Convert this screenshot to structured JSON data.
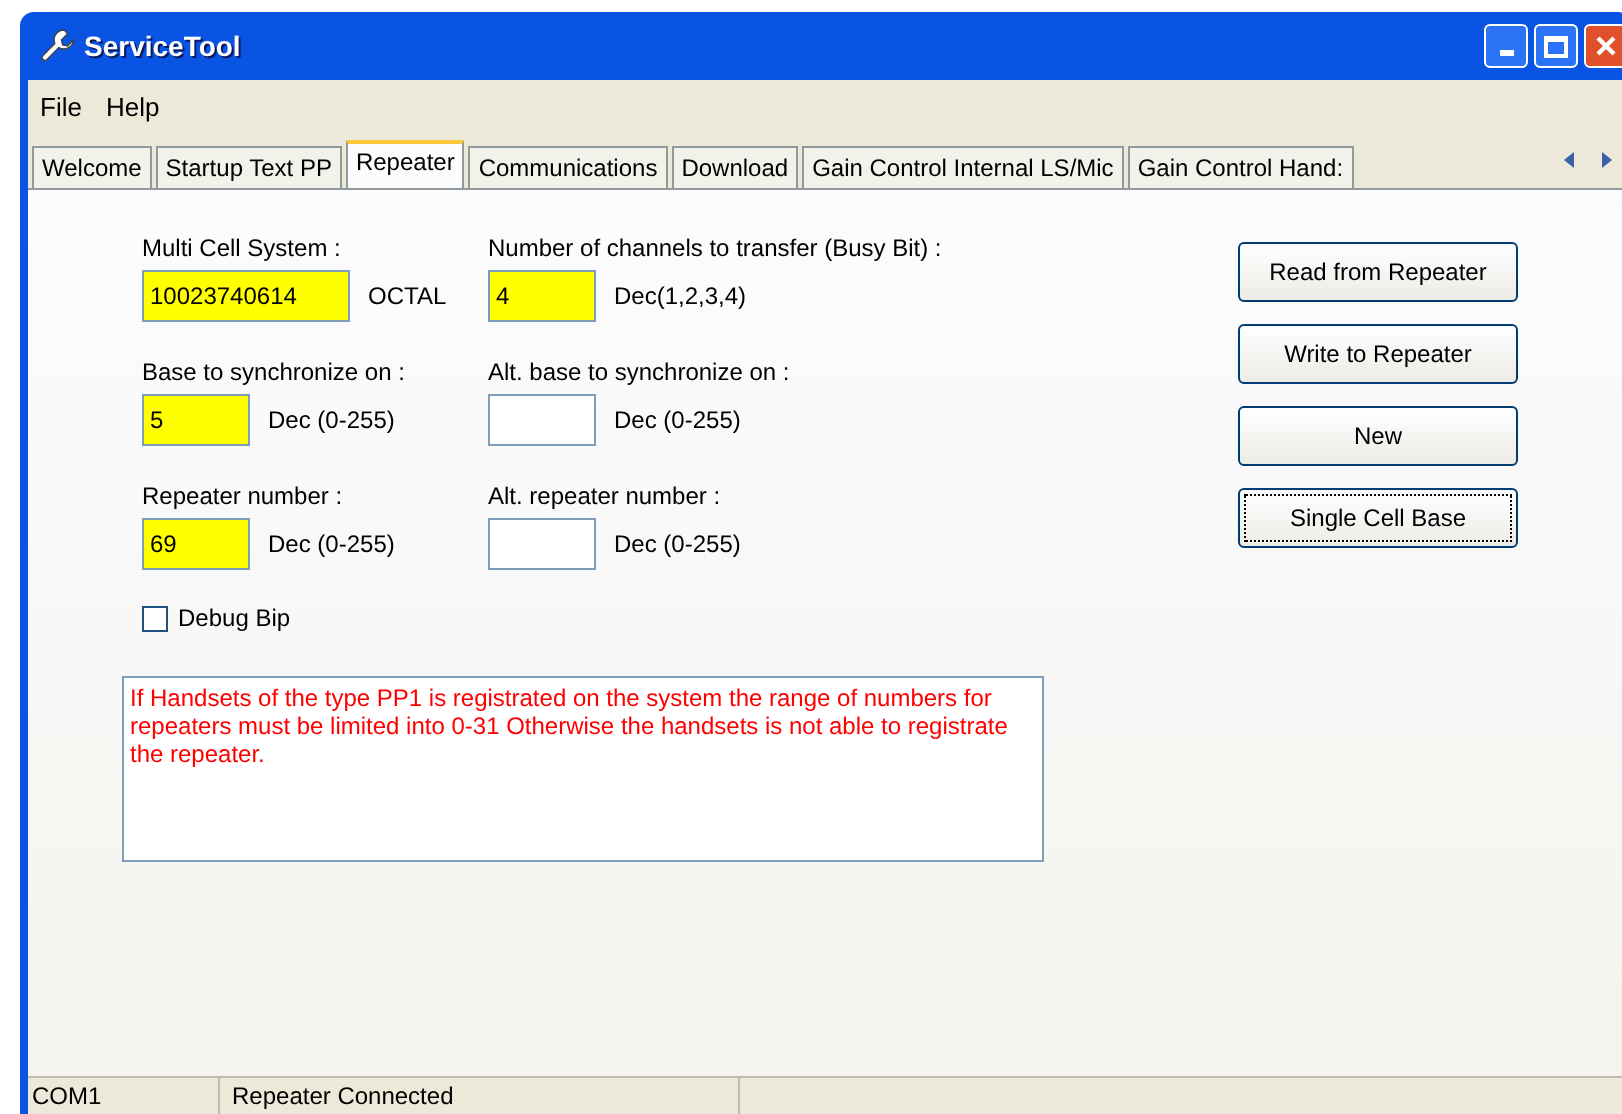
{
  "window": {
    "title": "ServiceTool"
  },
  "menu": [
    "File",
    "Help"
  ],
  "tabs": [
    {
      "label": "Welcome",
      "selected": false
    },
    {
      "label": "Startup Text PP",
      "selected": false
    },
    {
      "label": "Repeater",
      "selected": true
    },
    {
      "label": "Communications",
      "selected": false
    },
    {
      "label": "Download",
      "selected": false
    },
    {
      "label": "Gain Control Internal LS/Mic",
      "selected": false
    },
    {
      "label": "Gain Control Hand:",
      "selected": false
    }
  ],
  "fields": [
    {
      "label": "Multi Cell System :",
      "value": "10023740614",
      "unit": "OCTAL",
      "highlighted": true
    },
    {
      "label": "Number of channels to transfer (Busy Bit) :",
      "value": "4",
      "unit": "Dec(1,2,3,4)",
      "highlighted": true
    },
    {
      "label": "Base to synchronize on :",
      "value": "5",
      "unit": "Dec (0-255)",
      "highlighted": true
    },
    {
      "label": "Alt. base to synchronize on :",
      "unit": "Dec (0-255)",
      "highlighted": false
    },
    {
      "label": "Repeater number :",
      "value": "69",
      "unit": "Dec (0-255)",
      "highlighted": true
    },
    {
      "label": "Alt. repeater number :",
      "unit": "Dec (0-255)",
      "highlighted": false
    }
  ],
  "debug_checkbox": {
    "label": "Debug Bip",
    "checked": false
  },
  "info_text": "If Handsets of the type PP1 is registrated on the system the range of numbers for repeaters must be limited into 0-31 Otherwise the handsets is not able to registrate the repeater.",
  "buttons": [
    {
      "label": "Read from Repeater",
      "focused": false
    },
    {
      "label": "Write to Repeater",
      "focused": false
    },
    {
      "label": "New",
      "focused": false
    },
    {
      "label": "Single Cell Base",
      "focused": true
    }
  ],
  "status_bar": [
    "COM1",
    "Repeater Connected"
  ]
}
